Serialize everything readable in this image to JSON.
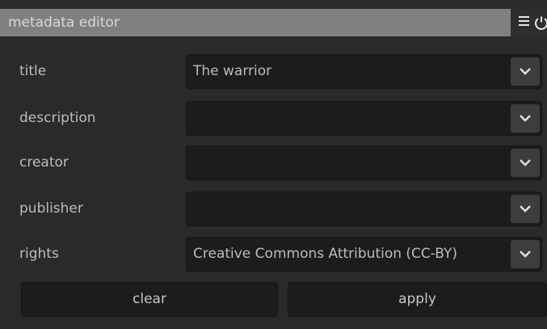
{
  "panel": {
    "title": "metadata editor",
    "header_icons": [
      "hamburger-menu-icon",
      "power-icon"
    ]
  },
  "fields": [
    {
      "label": "title",
      "value": "The warrior"
    },
    {
      "label": "description",
      "value": ""
    },
    {
      "label": "creator",
      "value": ""
    },
    {
      "label": "publisher",
      "value": ""
    },
    {
      "label": "rights",
      "value": "Creative Commons Attribution (CC-BY)"
    }
  ],
  "buttons": {
    "clear": "clear",
    "apply": "apply"
  },
  "colors": {
    "header_bg": "#808080",
    "panel_bg": "#2a2a2a",
    "field_bg": "#1c1c1c",
    "dropdown_button_bg": "#3d3d3d",
    "text": "#bcbcbc"
  }
}
